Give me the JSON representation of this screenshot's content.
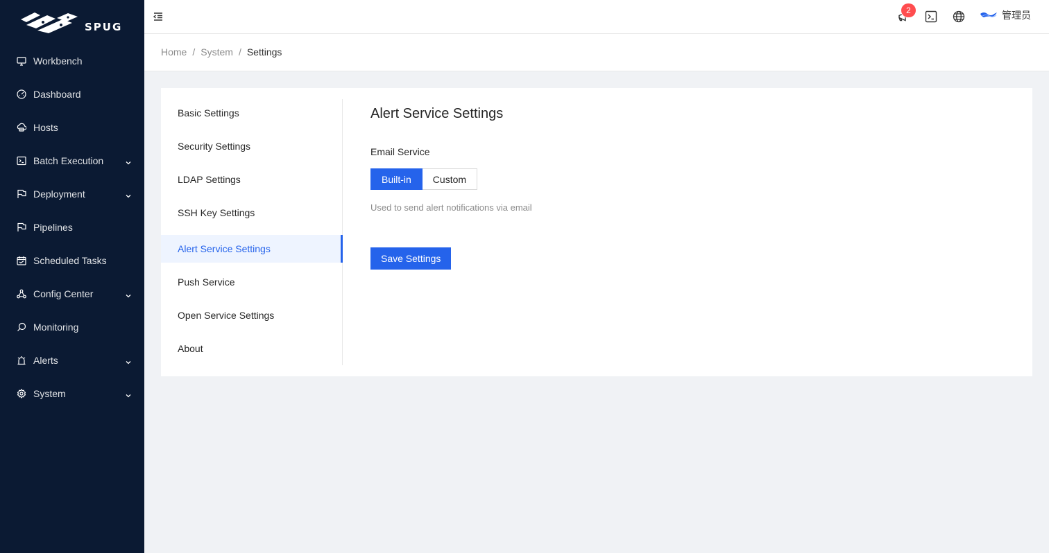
{
  "app": {
    "logo_text": "SPUG",
    "user_name": "管理员",
    "notification_count": "2"
  },
  "colors": {
    "sidebar_bg": "#0b1a33",
    "primary": "#2563eb",
    "badge": "#ff4d4f",
    "page_bg": "#f0f2f5"
  },
  "sidebar": {
    "items": [
      {
        "label": "Workbench",
        "icon": "desktop-icon",
        "expandable": false
      },
      {
        "label": "Dashboard",
        "icon": "dashboard-icon",
        "expandable": false
      },
      {
        "label": "Hosts",
        "icon": "cloud-server-icon",
        "expandable": false
      },
      {
        "label": "Batch Execution",
        "icon": "terminal-icon",
        "expandable": true
      },
      {
        "label": "Deployment",
        "icon": "flag-icon",
        "expandable": true
      },
      {
        "label": "Pipelines",
        "icon": "flag-icon",
        "expandable": false
      },
      {
        "label": "Scheduled Tasks",
        "icon": "schedule-icon",
        "expandable": false
      },
      {
        "label": "Config Center",
        "icon": "deployment-unit-icon",
        "expandable": true
      },
      {
        "label": "Monitoring",
        "icon": "monitor-search-icon",
        "expandable": false
      },
      {
        "label": "Alerts",
        "icon": "alert-icon",
        "expandable": true
      },
      {
        "label": "System",
        "icon": "setting-icon",
        "expandable": true
      }
    ]
  },
  "breadcrumb": {
    "items": [
      "Home",
      "System",
      "Settings"
    ]
  },
  "settings_menu": {
    "items": [
      "Basic Settings",
      "Security Settings",
      "LDAP Settings",
      "SSH Key Settings",
      "Alert Service Settings",
      "Push Service",
      "Open Service Settings",
      "About"
    ],
    "active": "Alert Service Settings"
  },
  "panel": {
    "title": "Alert Service Settings",
    "email_label": "Email Service",
    "options": [
      "Built-in",
      "Custom"
    ],
    "selected": "Built-in",
    "help": "Used to send alert notifications via email",
    "save_label": "Save Settings"
  }
}
